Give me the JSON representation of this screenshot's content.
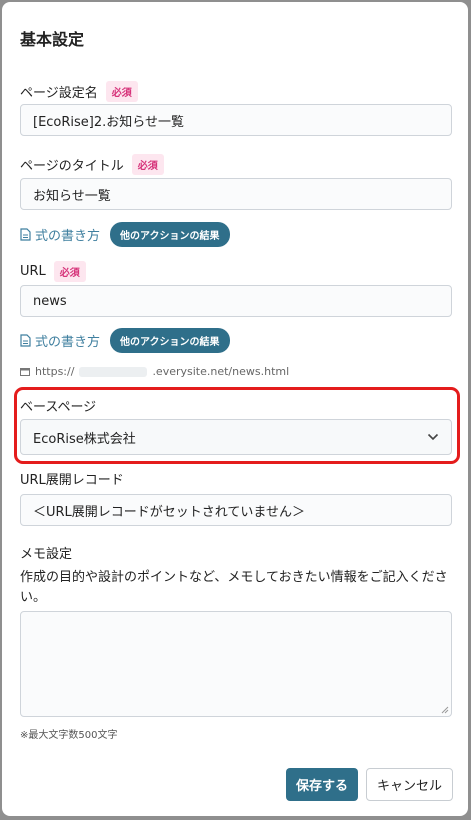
{
  "dialog": {
    "title": "基本設定",
    "required_badge": "必須",
    "page_setting_name": {
      "label": "ページ設定名",
      "value": "[EcoRise]2.お知らせ一覧"
    },
    "page_title": {
      "label": "ページのタイトル",
      "value": "お知らせ一覧",
      "formula_link": "式の書き方",
      "action_results": "他のアクションの結果"
    },
    "url": {
      "label": "URL",
      "value": "news",
      "formula_link": "式の書き方",
      "action_results": "他のアクションの結果",
      "preview_prefix": "https://",
      "preview_suffix": ".everysite.net/news.html"
    },
    "base_page": {
      "label": "ベースページ",
      "selected": "EcoRise株式会社"
    },
    "url_record": {
      "label": "URL展開レコード",
      "value": "＜URL展開レコードがセットされていません＞"
    },
    "memo": {
      "label": "メモ設定",
      "description": "作成の目的や設計のポイントなど、メモしておきたい情報をご記入ください。",
      "value": "",
      "limit_note": "※最大文字数500文字"
    },
    "buttons": {
      "save": "保存する",
      "cancel": "キャンセル"
    }
  },
  "colors": {
    "primary": "#2f6f8a",
    "required_text": "#d6337a",
    "required_bg": "#fde6ef",
    "link": "#3f7f9f",
    "highlight": "#e41c1c"
  },
  "icons": [
    "document-icon",
    "url-card-icon",
    "chevron-down-icon",
    "resize-handle-icon"
  ]
}
